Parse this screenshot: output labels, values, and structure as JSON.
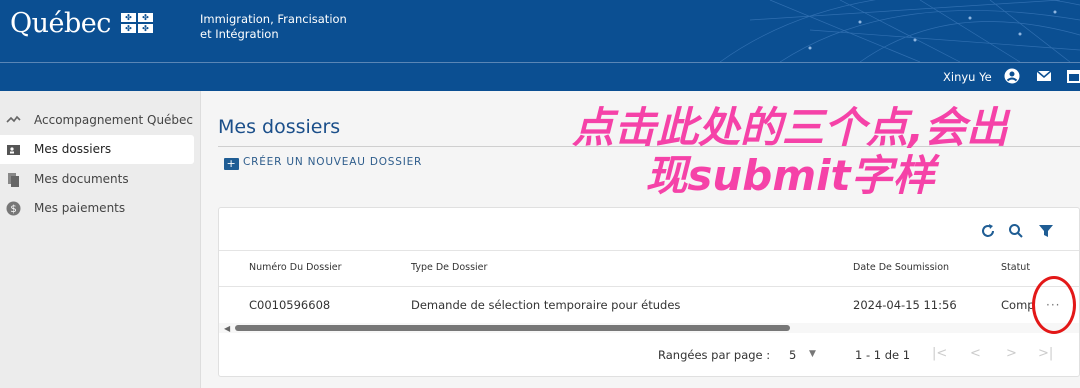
{
  "header": {
    "logo": "Québec",
    "ministry_line1": "Immigration, Francisation",
    "ministry_line2": "et Intégration"
  },
  "userbar": {
    "username": "Xinyu Ye"
  },
  "sidebar": {
    "items": [
      {
        "label": "Accompagnement Québec",
        "icon": "handshake-icon"
      },
      {
        "label": "Mes dossiers",
        "icon": "folder-user-icon",
        "active": true
      },
      {
        "label": "Mes documents",
        "icon": "documents-icon"
      },
      {
        "label": "Mes paiements",
        "icon": "dollar-icon"
      }
    ]
  },
  "main": {
    "title": "Mes dossiers",
    "new_button": "CRÉER UN NOUVEAU DOSSIER"
  },
  "table": {
    "columns": [
      "Numéro Du Dossier",
      "Type De Dossier",
      "Date De Soumission",
      "Statut"
    ],
    "rows": [
      {
        "numero": "C0010596608",
        "type": "Demande de sélection temporaire pour études",
        "date": "2024-04-15 11:56",
        "statut": "Comp"
      }
    ],
    "row_menu": "···"
  },
  "pagination": {
    "rows_label": "Rangées par page :",
    "rows_value": "5",
    "range": "1 - 1 de 1"
  },
  "annotation": {
    "line1": "点击此处的三个点,会出",
    "line2": "现submit字样",
    "color": "#f542a8",
    "circle_color": "#e31818"
  },
  "colors": {
    "brand": "#0b4f92",
    "accent": "#1f5d94"
  }
}
